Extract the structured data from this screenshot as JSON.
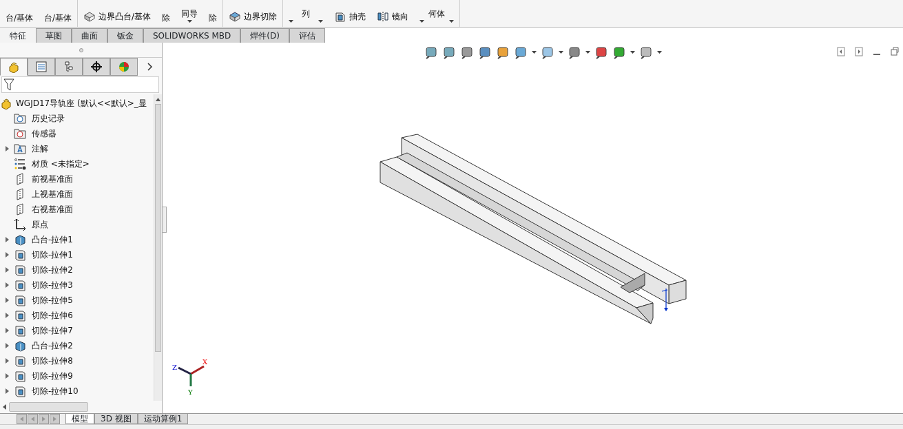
{
  "ribbon": {
    "groups": [
      {
        "lines": [
          "台/基体"
        ]
      },
      {
        "lines": [
          "台/基体"
        ]
      },
      {
        "items": [
          {
            "label": "边界凸台/基体",
            "kind": "boundary-boss"
          }
        ]
      },
      {
        "lines": [
          "除"
        ]
      },
      {
        "lines": [
          "同导"
        ],
        "dropdowns": [
          true
        ]
      },
      {
        "lines": [
          "除"
        ]
      },
      {
        "items": [
          {
            "label": "边界切除",
            "kind": "boundary-cut"
          }
        ]
      },
      {
        "dropdowns": [
          true,
          true
        ],
        "lines": [
          "列"
        ]
      },
      {
        "items": [
          {
            "label": "抽壳",
            "kind": "shell"
          }
        ]
      },
      {
        "items": [
          {
            "label": "镜向",
            "kind": "mirror"
          }
        ]
      },
      {
        "lines": [
          "何体"
        ],
        "dropdowns": [
          true,
          true
        ]
      }
    ]
  },
  "command_tabs": [
    {
      "label": "特征",
      "selected": true
    },
    {
      "label": "草图",
      "selected": false
    },
    {
      "label": "曲面",
      "selected": false
    },
    {
      "label": "钣金",
      "selected": false
    },
    {
      "label": "SOLIDWORKS MBD",
      "selected": false
    },
    {
      "label": "焊件(D)",
      "selected": false
    },
    {
      "label": "评估",
      "selected": false
    }
  ],
  "panel_tabs": [
    {
      "kind": "feature",
      "selected": true
    },
    {
      "kind": "property",
      "selected": false
    },
    {
      "kind": "config",
      "selected": false
    },
    {
      "kind": "dim",
      "selected": false
    },
    {
      "kind": "display",
      "selected": false
    }
  ],
  "tree": {
    "root": "WGJD17导轨座 (默认<<默认>_显",
    "items": [
      {
        "label": "历史记录",
        "kind": "history",
        "expandable": false
      },
      {
        "label": "传感器",
        "kind": "sensor",
        "expandable": false
      },
      {
        "label": "注解",
        "kind": "annotation",
        "expandable": true
      },
      {
        "label": "材质 <未指定>",
        "kind": "material",
        "expandable": false
      },
      {
        "label": "前视基准面",
        "kind": "plane",
        "expandable": false
      },
      {
        "label": "上视基准面",
        "kind": "plane",
        "expandable": false
      },
      {
        "label": "右视基准面",
        "kind": "plane",
        "expandable": false
      },
      {
        "label": "原点",
        "kind": "origin",
        "expandable": false
      },
      {
        "label": "凸台-拉伸1",
        "kind": "boss",
        "expandable": true
      },
      {
        "label": "切除-拉伸1",
        "kind": "cut",
        "expandable": true
      },
      {
        "label": "切除-拉伸2",
        "kind": "cut",
        "expandable": true
      },
      {
        "label": "切除-拉伸3",
        "kind": "cut",
        "expandable": true
      },
      {
        "label": "切除-拉伸5",
        "kind": "cut",
        "expandable": true
      },
      {
        "label": "切除-拉伸6",
        "kind": "cut",
        "expandable": true
      },
      {
        "label": "切除-拉伸7",
        "kind": "cut",
        "expandable": true
      },
      {
        "label": "凸台-拉伸2",
        "kind": "boss",
        "expandable": true
      },
      {
        "label": "切除-拉伸8",
        "kind": "cut",
        "expandable": true
      },
      {
        "label": "切除-拉伸9",
        "kind": "cut",
        "expandable": true
      },
      {
        "label": "切除-拉伸10",
        "kind": "cut",
        "expandable": true
      }
    ]
  },
  "triad": {
    "x": "X",
    "y": "Y",
    "z": "Z"
  },
  "bottom_tabs": [
    {
      "label": "模型",
      "selected": true
    },
    {
      "label": "3D 视图",
      "selected": false
    },
    {
      "label": "运动算例1",
      "selected": false
    }
  ]
}
